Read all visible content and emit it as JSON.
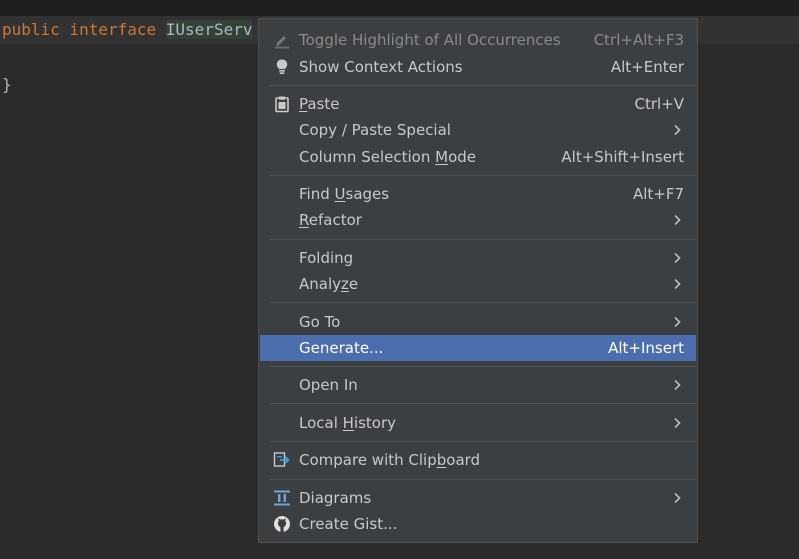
{
  "editor": {
    "line1": {
      "kw1": "public",
      "kw2": "interface",
      "cls": "IUserServ"
    },
    "line2": "}"
  },
  "menu": {
    "toggle_highlight": {
      "label": "Toggle Highlight of All Occurrences",
      "shortcut": "Ctrl+Alt+F3"
    },
    "context_actions": {
      "label": "Show Context Actions",
      "shortcut": "Alt+Enter"
    },
    "paste": {
      "mn": "P",
      "rest": "aste",
      "shortcut": "Ctrl+V"
    },
    "copy_paste_special": {
      "label": "Copy / Paste Special"
    },
    "column_selection": {
      "pre": "Column Selection ",
      "mn": "M",
      "post": "ode",
      "shortcut": "Alt+Shift+Insert"
    },
    "find_usages": {
      "pre": "Find ",
      "mn": "U",
      "post": "sages",
      "shortcut": "Alt+F7"
    },
    "refactor": {
      "mn": "R",
      "post": "efactor"
    },
    "folding": {
      "label": "Folding"
    },
    "analyze": {
      "pre": "Analy",
      "mn": "z",
      "post": "e"
    },
    "goto": {
      "label": "Go To"
    },
    "generate": {
      "label": "Generate...",
      "shortcut": "Alt+Insert"
    },
    "open_in": {
      "label": "Open In"
    },
    "local_history": {
      "pre": "Local ",
      "mn": "H",
      "post": "istory"
    },
    "compare_clipboard": {
      "pre": "Compare with Clip",
      "mn": "b",
      "post": "oard"
    },
    "diagrams": {
      "label": "Diagrams"
    },
    "create_gist": {
      "label": "Create Gist..."
    }
  },
  "colors": {
    "menu_bg": "#3c3f41",
    "selection": "#4b6eaf",
    "keyword": "#cc7832",
    "separator": "#515151"
  },
  "icons": {
    "toggle_highlight": "pencil-highlight-icon",
    "context_actions": "lightbulb-icon",
    "paste": "clipboard-icon",
    "compare_clipboard": "compare-icon",
    "diagrams": "diagram-icon",
    "create_gist": "github-icon"
  }
}
